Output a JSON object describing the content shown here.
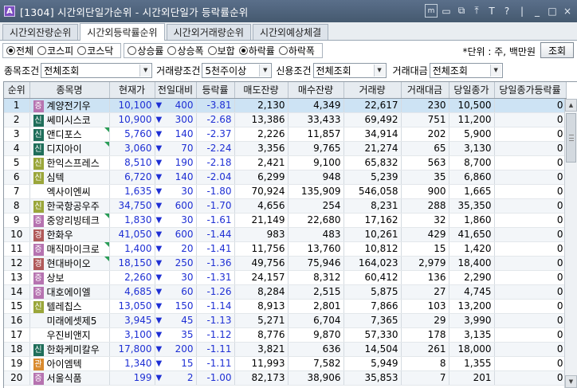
{
  "window": {
    "title": "[1304]  시간외단일가순위 - 시간외단일가 등락률순위",
    "app_icon": "A",
    "controls": [
      "m",
      "▭",
      "⧉",
      "⤒",
      "T",
      "?",
      "|",
      "_",
      "□",
      "×"
    ]
  },
  "tabs": [
    {
      "label": "시간외잔량순위",
      "active": false
    },
    {
      "label": "시간외등락률순위",
      "active": true
    },
    {
      "label": "시간외거래량순위",
      "active": false
    },
    {
      "label": "시간외예상체결",
      "active": false
    }
  ],
  "market_filter": [
    {
      "label": "전체",
      "selected": true
    },
    {
      "label": "코스피",
      "selected": false
    },
    {
      "label": "코스닥",
      "selected": false
    }
  ],
  "sort_filter": [
    {
      "label": "상승률",
      "selected": false
    },
    {
      "label": "상승폭",
      "selected": false
    },
    {
      "label": "보합",
      "selected": false
    },
    {
      "label": "하락률",
      "selected": true
    },
    {
      "label": "하락폭",
      "selected": false
    }
  ],
  "unit_label": "*단위 : 주, 백만원",
  "lookup_button": "조회",
  "conditions": {
    "stock_label": "종목조건",
    "stock_value": "전체조회",
    "volume_label": "거래량조건",
    "volume_value": "5천주이상",
    "credit_label": "신용조건",
    "credit_value": "전체조회",
    "amount_label": "거래대금",
    "amount_value": "전체조회"
  },
  "columns": [
    "순위",
    "종목명",
    "현재가",
    "전일대비",
    "등락률",
    "매도잔량",
    "매수잔량",
    "거래량",
    "거래대금",
    "당일종가",
    "당일종가등락률"
  ],
  "badge_colors": {
    "증": "#b04a9a",
    "신": "#1f6e5a",
    "신2": "#8c9a2a",
    "경": "#9d3a3a",
    "관": "#c96a18"
  },
  "rows": [
    {
      "rank": "1",
      "badge": "증",
      "badge_color": "#b673b0",
      "name": "계양전기우",
      "price": "10,100",
      "diff": "400",
      "rate": "-3.81",
      "sell": "2,130",
      "buy": "4,349",
      "vol": "22,617",
      "amt": "230",
      "close": "10,500",
      "close_rate": "0",
      "corner": false
    },
    {
      "rank": "2",
      "badge": "신",
      "badge_color": "#1f6e5a",
      "name": "쎄미시스코",
      "price": "10,900",
      "diff": "300",
      "rate": "-2.68",
      "sell": "13,386",
      "buy": "33,433",
      "vol": "69,492",
      "amt": "751",
      "close": "11,200",
      "close_rate": "0",
      "corner": false
    },
    {
      "rank": "3",
      "badge": "신",
      "badge_color": "#1f6e5a",
      "name": "앤디포스",
      "price": "5,760",
      "diff": "140",
      "rate": "-2.37",
      "sell": "2,226",
      "buy": "11,857",
      "vol": "34,914",
      "amt": "202",
      "close": "5,900",
      "close_rate": "0",
      "corner": true
    },
    {
      "rank": "4",
      "badge": "신",
      "badge_color": "#1f6e5a",
      "name": "디지아이",
      "price": "3,060",
      "diff": "70",
      "rate": "-2.24",
      "sell": "3,356",
      "buy": "9,765",
      "vol": "21,274",
      "amt": "65",
      "close": "3,130",
      "close_rate": "0",
      "corner": true
    },
    {
      "rank": "5",
      "badge": "신",
      "badge_color": "#9aa63a",
      "name": "한익스프레스",
      "price": "8,510",
      "diff": "190",
      "rate": "-2.18",
      "sell": "2,421",
      "buy": "9,100",
      "vol": "65,832",
      "amt": "563",
      "close": "8,700",
      "close_rate": "0",
      "corner": false
    },
    {
      "rank": "6",
      "badge": "신",
      "badge_color": "#9aa63a",
      "name": "심텍",
      "price": "6,720",
      "diff": "140",
      "rate": "-2.04",
      "sell": "6,299",
      "buy": "948",
      "vol": "5,239",
      "amt": "35",
      "close": "6,860",
      "close_rate": "0",
      "corner": false
    },
    {
      "rank": "7",
      "badge": "",
      "badge_color": "",
      "name": "엑사이엔씨",
      "price": "1,635",
      "diff": "30",
      "rate": "-1.80",
      "sell": "70,924",
      "buy": "135,909",
      "vol": "546,058",
      "amt": "900",
      "close": "1,665",
      "close_rate": "0",
      "corner": false
    },
    {
      "rank": "8",
      "badge": "신",
      "badge_color": "#9aa63a",
      "name": "한국항공우주",
      "price": "34,750",
      "diff": "600",
      "rate": "-1.70",
      "sell": "4,656",
      "buy": "254",
      "vol": "8,231",
      "amt": "288",
      "close": "35,350",
      "close_rate": "0",
      "corner": false
    },
    {
      "rank": "9",
      "badge": "증",
      "badge_color": "#b673b0",
      "name": "중앙리빙테크",
      "price": "1,830",
      "diff": "30",
      "rate": "-1.61",
      "sell": "21,149",
      "buy": "22,680",
      "vol": "17,162",
      "amt": "32",
      "close": "1,860",
      "close_rate": "0",
      "corner": true
    },
    {
      "rank": "10",
      "badge": "경",
      "badge_color": "#b05a5a",
      "name": "한화우",
      "price": "41,050",
      "diff": "600",
      "rate": "-1.44",
      "sell": "983",
      "buy": "483",
      "vol": "10,261",
      "amt": "429",
      "close": "41,650",
      "close_rate": "0",
      "corner": false
    },
    {
      "rank": "11",
      "badge": "증",
      "badge_color": "#b673b0",
      "name": "매직마이크로",
      "price": "1,400",
      "diff": "20",
      "rate": "-1.41",
      "sell": "11,756",
      "buy": "13,760",
      "vol": "10,812",
      "amt": "15",
      "close": "1,420",
      "close_rate": "0",
      "corner": true
    },
    {
      "rank": "12",
      "badge": "경",
      "badge_color": "#b05a5a",
      "name": "현대바이오",
      "price": "18,150",
      "diff": "250",
      "rate": "-1.36",
      "sell": "49,756",
      "buy": "75,946",
      "vol": "164,023",
      "amt": "2,979",
      "close": "18,400",
      "close_rate": "0",
      "corner": true
    },
    {
      "rank": "13",
      "badge": "증",
      "badge_color": "#b673b0",
      "name": "상보",
      "price": "2,260",
      "diff": "30",
      "rate": "-1.31",
      "sell": "24,157",
      "buy": "8,312",
      "vol": "60,412",
      "amt": "136",
      "close": "2,290",
      "close_rate": "0",
      "corner": false
    },
    {
      "rank": "14",
      "badge": "증",
      "badge_color": "#b673b0",
      "name": "대호에이엘",
      "price": "4,685",
      "diff": "60",
      "rate": "-1.26",
      "sell": "8,284",
      "buy": "2,515",
      "vol": "5,875",
      "amt": "27",
      "close": "4,745",
      "close_rate": "0",
      "corner": false
    },
    {
      "rank": "15",
      "badge": "신",
      "badge_color": "#9aa63a",
      "name": "텔레칩스",
      "price": "13,050",
      "diff": "150",
      "rate": "-1.14",
      "sell": "8,913",
      "buy": "2,801",
      "vol": "7,866",
      "amt": "103",
      "close": "13,200",
      "close_rate": "0",
      "corner": false
    },
    {
      "rank": "16",
      "badge": "",
      "badge_color": "",
      "name": "미래에셋제5",
      "price": "3,945",
      "diff": "45",
      "rate": "-1.13",
      "sell": "5,271",
      "buy": "6,704",
      "vol": "7,365",
      "amt": "29",
      "close": "3,990",
      "close_rate": "0",
      "corner": false
    },
    {
      "rank": "17",
      "badge": "",
      "badge_color": "",
      "name": "우진비앤지",
      "price": "3,100",
      "diff": "35",
      "rate": "-1.12",
      "sell": "8,776",
      "buy": "9,870",
      "vol": "57,330",
      "amt": "178",
      "close": "3,135",
      "close_rate": "0",
      "corner": false
    },
    {
      "rank": "18",
      "badge": "신",
      "badge_color": "#1f6e5a",
      "name": "한화케미칼우",
      "price": "17,800",
      "diff": "200",
      "rate": "-1.11",
      "sell": "3,821",
      "buy": "636",
      "vol": "14,504",
      "amt": "261",
      "close": "18,000",
      "close_rate": "0",
      "corner": false
    },
    {
      "rank": "19",
      "badge": "관",
      "badge_color": "#d98a2e",
      "name": "아이엠텍",
      "price": "1,340",
      "diff": "15",
      "rate": "-1.11",
      "sell": "11,993",
      "buy": "7,582",
      "vol": "5,949",
      "amt": "8",
      "close": "1,355",
      "close_rate": "0",
      "corner": false
    },
    {
      "rank": "20",
      "badge": "증",
      "badge_color": "#b673b0",
      "name": "서울식품",
      "price": "199",
      "diff": "2",
      "rate": "-1.00",
      "sell": "82,173",
      "buy": "38,906",
      "vol": "35,853",
      "amt": "7",
      "close": "201",
      "close_rate": "0",
      "corner": false
    }
  ]
}
